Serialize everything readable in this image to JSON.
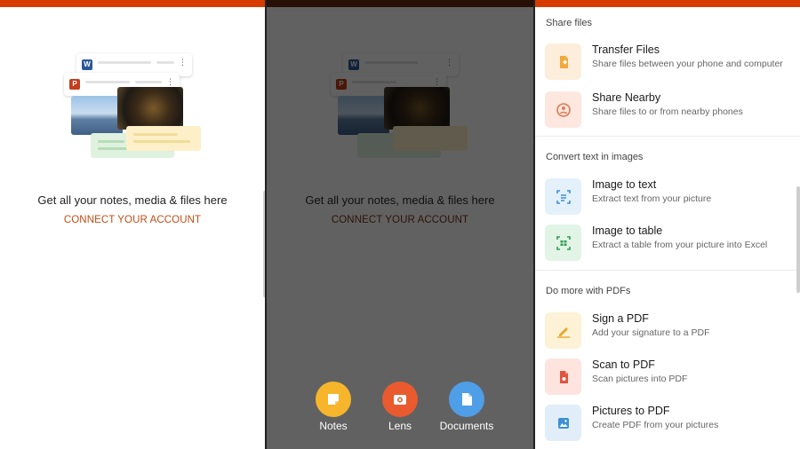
{
  "home": {
    "heading": "Get all your notes, media & files here",
    "connect": "CONNECT YOUR ACCOUNT",
    "badge_word": "W",
    "badge_ppt": "P"
  },
  "fabs": [
    {
      "label": "Notes",
      "color": "#f7b52c",
      "icon": "note-icon"
    },
    {
      "label": "Lens",
      "color": "#ea5a2f",
      "icon": "camera-icon"
    },
    {
      "label": "Documents",
      "color": "#4f9ee8",
      "icon": "document-icon"
    }
  ],
  "tools": {
    "sections": [
      {
        "title": "Share files",
        "items": [
          {
            "title": "Transfer Files",
            "desc": "Share files between your phone and computer",
            "icon": "transfer-files-icon"
          },
          {
            "title": "Share Nearby",
            "desc": "Share files to or from nearby phones",
            "icon": "share-nearby-icon"
          }
        ]
      },
      {
        "title": "Convert text in images",
        "items": [
          {
            "title": "Image to text",
            "desc": "Extract text from your picture",
            "icon": "image-to-text-icon"
          },
          {
            "title": "Image to table",
            "desc": "Extract a table from your picture into Excel",
            "icon": "image-to-table-icon"
          }
        ]
      },
      {
        "title": "Do more with PDFs",
        "items": [
          {
            "title": "Sign a PDF",
            "desc": "Add your signature to a PDF",
            "icon": "sign-pdf-icon"
          },
          {
            "title": "Scan to PDF",
            "desc": "Scan pictures into PDF",
            "icon": "scan-to-pdf-icon"
          },
          {
            "title": "Pictures to PDF",
            "desc": "Create PDF from your pictures",
            "icon": "pictures-to-pdf-icon"
          }
        ]
      }
    ]
  },
  "colors": {
    "accent": "#d83b01",
    "link": "#c14d17"
  }
}
